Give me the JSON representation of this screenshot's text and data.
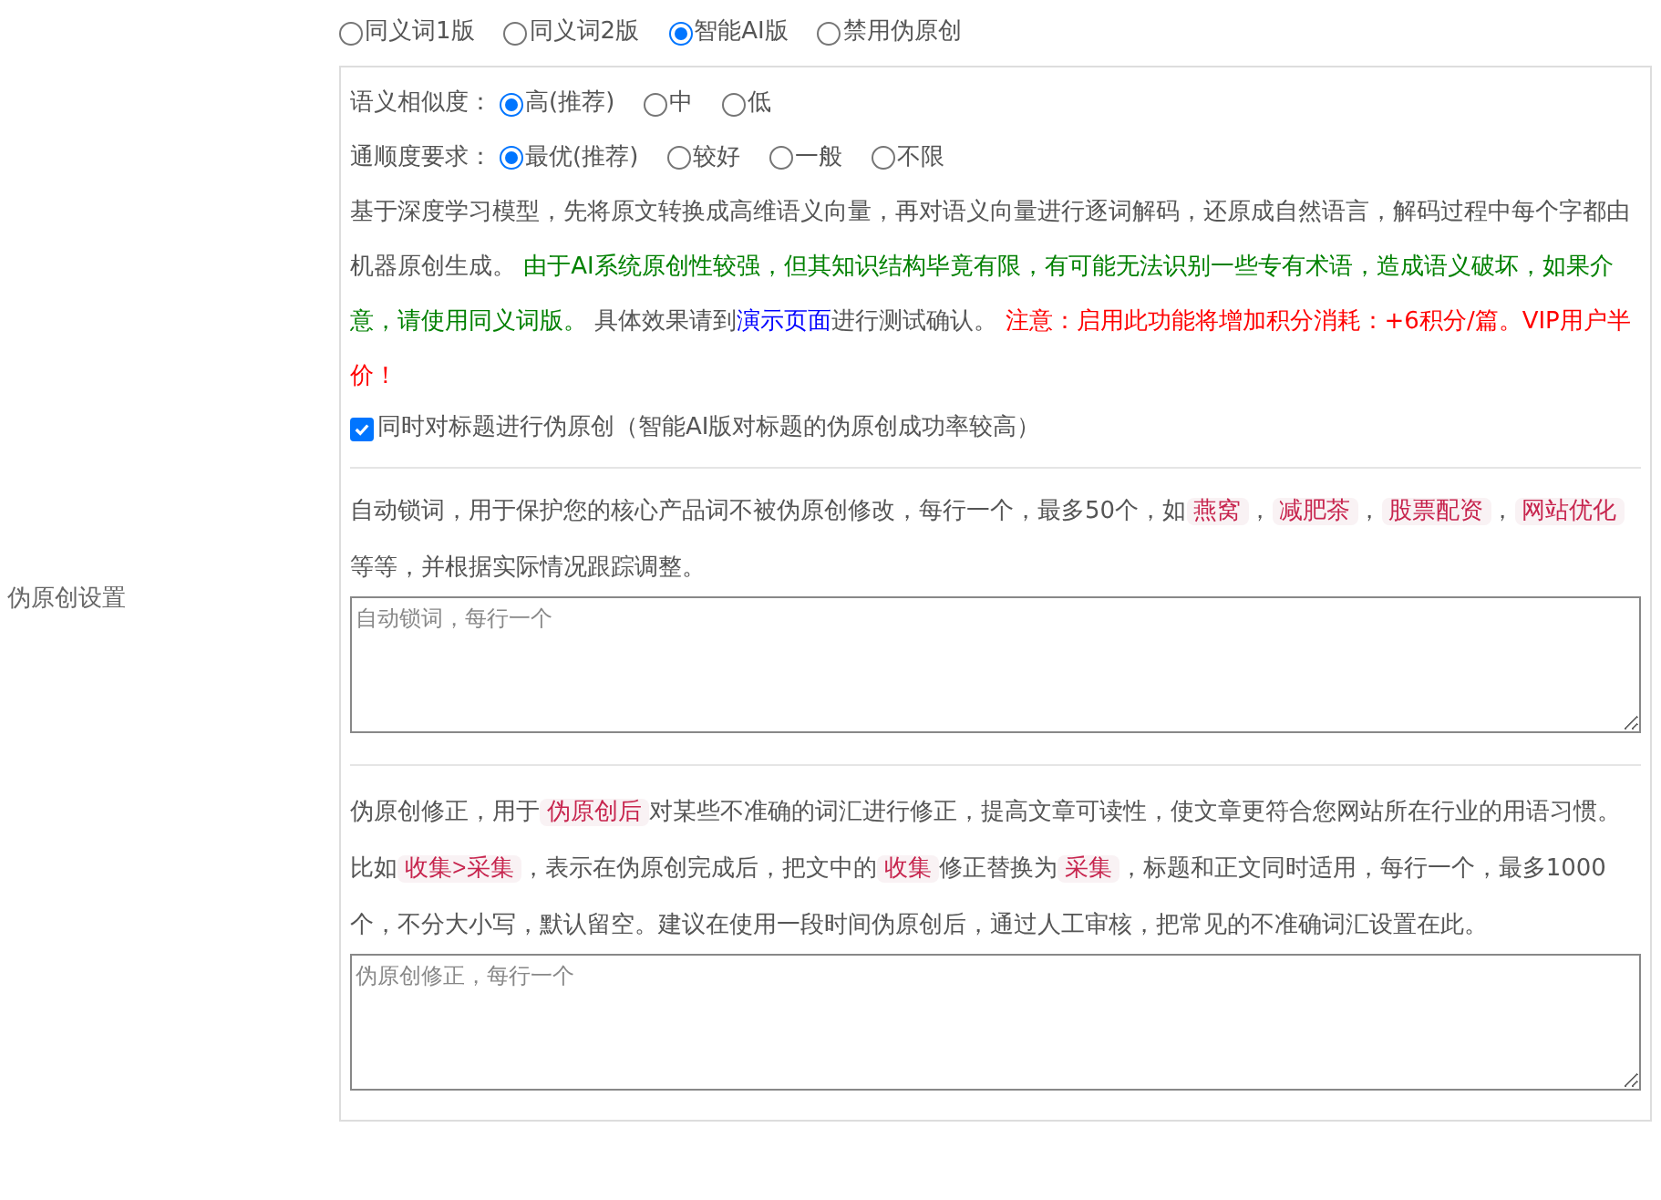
{
  "label": "伪原创设置",
  "modes": [
    {
      "label": "同义词1版",
      "selected": false
    },
    {
      "label": "同义词2版",
      "selected": false
    },
    {
      "label": "智能AI版",
      "selected": true
    },
    {
      "label": "禁用伪原创",
      "selected": false
    }
  ],
  "similarity": {
    "label": "语义相似度：",
    "options": [
      {
        "label": "高(推荐)",
        "selected": true
      },
      {
        "label": "中",
        "selected": false
      },
      {
        "label": "低",
        "selected": false
      }
    ]
  },
  "fluency": {
    "label": "通顺度要求：",
    "options": [
      {
        "label": "最优(推荐)",
        "selected": true
      },
      {
        "label": "较好",
        "selected": false
      },
      {
        "label": "一般",
        "selected": false
      },
      {
        "label": "不限",
        "selected": false
      }
    ]
  },
  "ai_note": [
    {
      "kind": "plain",
      "text": "基于深度学习模型，先将原文转换成高维语义向量，再对语义向量进行逐词解码，还原成自然语言，解码过程中每个字都由机器原创生成。 "
    },
    {
      "kind": "green",
      "text": "由于AI系统原创性较强，但其知识结构毕竟有限，有可能无法识别一些专有术语，造成语义破坏，如果介意，请使用同义词版。"
    },
    {
      "kind": "plain",
      "text": " 具体效果请到"
    },
    {
      "kind": "link",
      "text": "演示页面"
    },
    {
      "kind": "plain",
      "text": "进行测试确认。 "
    },
    {
      "kind": "red",
      "text": "注意：启用此功能将增加积分消耗：+6积分/篇。VIP用户半价！"
    }
  ],
  "title_option": {
    "label": "同时对标题进行伪原创（智能AI版对标题的伪原创成功率较高）",
    "checked": true
  },
  "lock_note": [
    {
      "kind": "plain",
      "text": "自动锁词，用于保护您的核心产品词不被伪原创修改，每行一个，最多50个，如"
    },
    {
      "kind": "code",
      "text": "燕窝"
    },
    {
      "kind": "plain",
      "text": "，"
    },
    {
      "kind": "code",
      "text": "减肥茶"
    },
    {
      "kind": "plain",
      "text": "，"
    },
    {
      "kind": "code",
      "text": "股票配资"
    },
    {
      "kind": "plain",
      "text": "，"
    },
    {
      "kind": "code",
      "text": "网站优化"
    },
    {
      "kind": "plain",
      "text": "等等，并根据实际情况跟踪调整。"
    }
  ],
  "lock_field": {
    "placeholder": "自动锁词，每行一个"
  },
  "fix_note": [
    {
      "kind": "plain",
      "text": "伪原创修正，用于"
    },
    {
      "kind": "code",
      "text": "伪原创后"
    },
    {
      "kind": "plain",
      "text": "对某些不准确的词汇进行修正，提高文章可读性，使文章更符合您网站所在行业的用语习惯。比如"
    },
    {
      "kind": "code",
      "text": "收集>采集"
    },
    {
      "kind": "plain",
      "text": "，表示在伪原创完成后，把文中的"
    },
    {
      "kind": "code",
      "text": "收集"
    },
    {
      "kind": "plain",
      "text": "修正替换为"
    },
    {
      "kind": "code",
      "text": "采集"
    },
    {
      "kind": "plain",
      "text": "，标题和正文同时适用，每行一个，最多1000个，不分大小写，默认留空。建议在使用一段时间伪原创后，通过人工审核，把常见的不准确词汇设置在此。"
    }
  ],
  "fix_field": {
    "placeholder": "伪原创修正，每行一个"
  }
}
